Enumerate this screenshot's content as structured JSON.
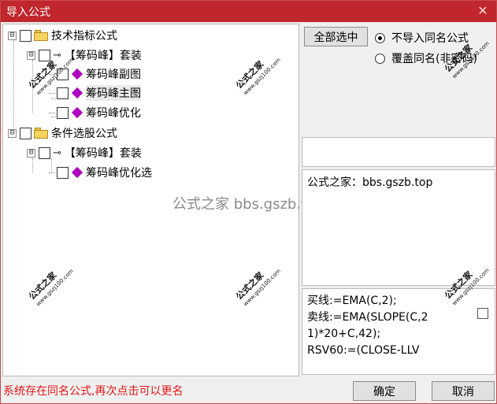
{
  "window": {
    "title": "导入公式"
  },
  "tree": {
    "items": [
      {
        "label": "技术指标公式",
        "expander": "⊟"
      },
      {
        "label": "【筹码峰】套装",
        "expander": "⊟"
      },
      {
        "label": "筹码峰副图"
      },
      {
        "label": "筹码峰主图"
      },
      {
        "label": "筹码峰优化"
      },
      {
        "label": "条件选股公式",
        "expander": "⊟"
      },
      {
        "label": "【筹码峰】套装",
        "expander": "⊟"
      },
      {
        "label": "筹码峰优化选"
      }
    ]
  },
  "options": {
    "select_all_label": "全部选中",
    "radio_no_import": "不导入同名公式",
    "radio_overwrite": "覆盖同名(非密码)"
  },
  "description": {
    "text": "公式之家：bbs.gszb.top"
  },
  "code": {
    "text": "买线:=EMA(C,2);\n卖线:=EMA(SLOPE(C,21)*20+C,42);\nRSV60:=(CLOSE-LLV"
  },
  "status": {
    "message": "系统存在同名公式,再次点击可以更名"
  },
  "buttons": {
    "ok": "确定",
    "cancel": "取消"
  },
  "close_icon": "✕",
  "watermarks": {
    "brand": "公式之家",
    "site": "www.gszj100.com",
    "center": "公式之家 bbs.gszb.top"
  },
  "colors": {
    "title_bar": "#c0262c",
    "status_text": "#e01818",
    "folder": "#f6d35c",
    "formula_icon": "#b000c0"
  }
}
